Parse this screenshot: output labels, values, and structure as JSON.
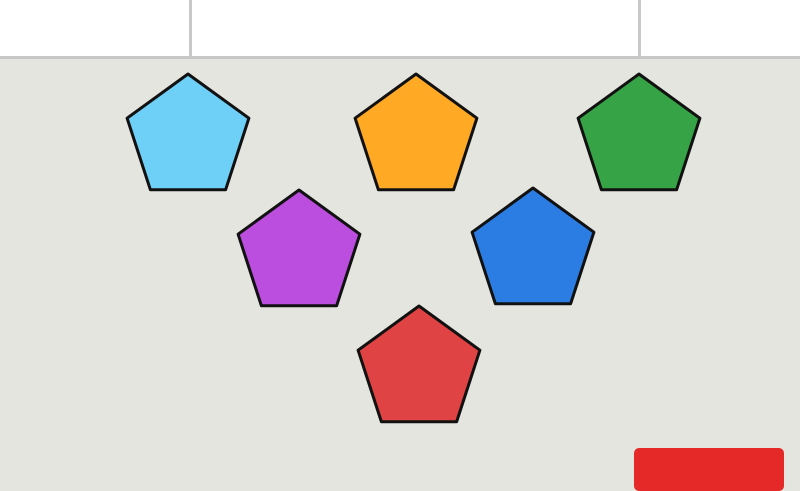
{
  "header": {
    "left_text": "",
    "center_text": "",
    "right_text": ""
  },
  "pieces": [
    {
      "id": "light-blue",
      "color": "#6fd0f7"
    },
    {
      "id": "orange",
      "color": "#ffa924"
    },
    {
      "id": "green",
      "color": "#36a346"
    },
    {
      "id": "purple",
      "color": "#bb4edf"
    },
    {
      "id": "blue",
      "color": "#2c7de3"
    },
    {
      "id": "red",
      "color": "#e04343"
    }
  ],
  "action_button": {
    "label": "",
    "color": "#e52828"
  }
}
